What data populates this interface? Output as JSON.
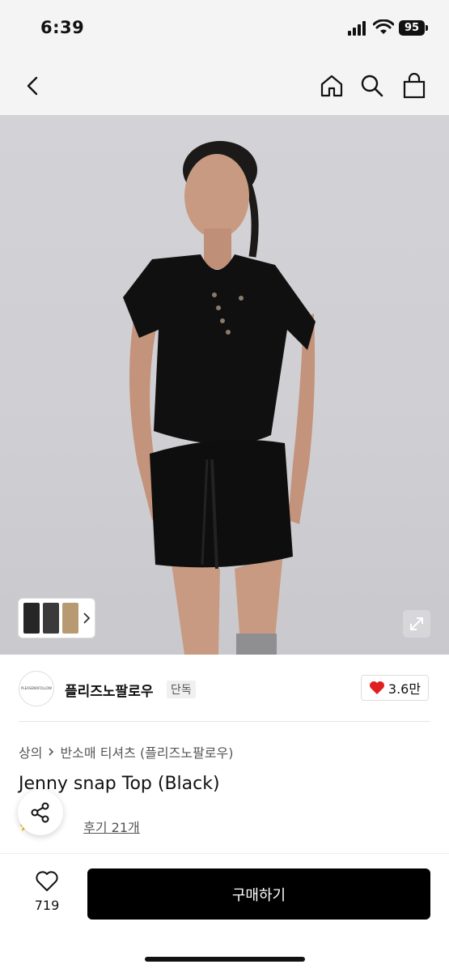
{
  "status": {
    "time": "6:39",
    "battery": "95"
  },
  "nav": {
    "back_icon": "chevron-left-icon",
    "home_icon": "home-icon",
    "search_icon": "search-icon",
    "cart_icon": "bag-icon"
  },
  "seller": {
    "logo_text": "PLEASENOFOLLOW",
    "name": "플리즈노팔로우",
    "badge": "단독",
    "likes": "3.6만"
  },
  "breadcrumb": {
    "items": [
      "상의",
      "반소매 티셔츠 (플리즈노팔로우)"
    ]
  },
  "product": {
    "title": "Jenny snap Top (Black)",
    "review_label": "후기 21개"
  },
  "bottom": {
    "fav_count": "719",
    "buy_label": "구매하기"
  },
  "colors": {
    "accent": "#000000",
    "heart": "#e02020",
    "star": "#f4b400"
  }
}
